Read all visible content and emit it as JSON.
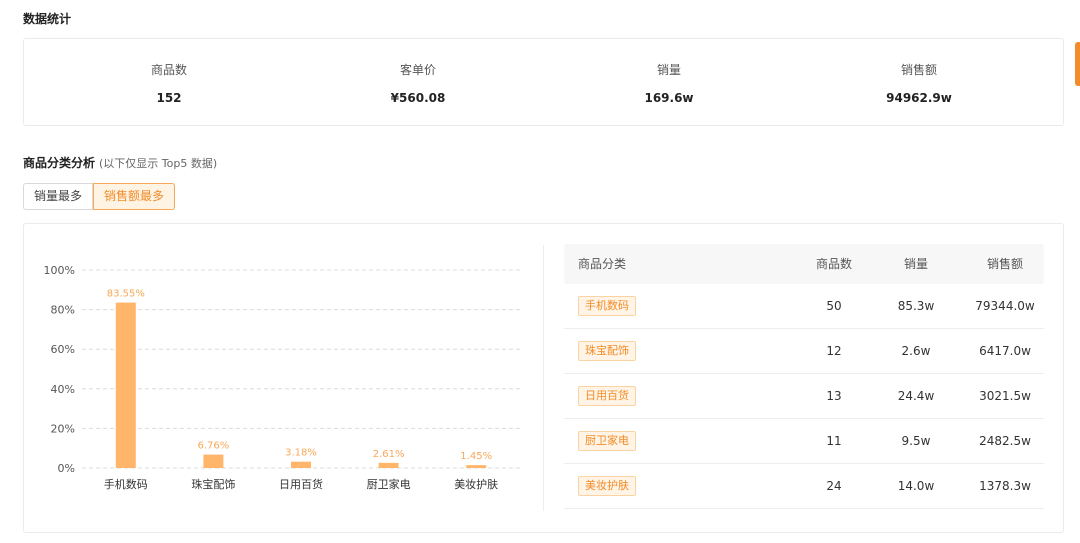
{
  "stats_section": {
    "title": "数据统计",
    "items": [
      {
        "label": "商品数",
        "value": "152"
      },
      {
        "label": "客单价",
        "value": "¥560.08"
      },
      {
        "label": "销量",
        "value": "169.6w"
      },
      {
        "label": "销售额",
        "value": "94962.9w"
      }
    ]
  },
  "category_section": {
    "title": "商品分类分析",
    "subtitle": "(以下仅显示 Top5 数据)",
    "tabs": [
      {
        "label": "销量最多",
        "active": false
      },
      {
        "label": "销售额最多",
        "active": true
      }
    ]
  },
  "chart_data": {
    "type": "bar",
    "categories": [
      "手机数码",
      "珠宝配饰",
      "日用百货",
      "厨卫家电",
      "美妆护肤"
    ],
    "values": [
      83.55,
      6.76,
      3.18,
      2.61,
      1.45
    ],
    "value_labels": [
      "83.55%",
      "6.76%",
      "3.18%",
      "2.61%",
      "1.45%"
    ],
    "y_ticks": [
      "0%",
      "20%",
      "40%",
      "60%",
      "80%",
      "100%"
    ],
    "ylim": [
      0,
      100
    ],
    "grid": true,
    "bar_color": "#ffb66b",
    "label_color": "#f7a858"
  },
  "table": {
    "headers": [
      "商品分类",
      "商品数",
      "销量",
      "销售额"
    ],
    "rows": [
      {
        "category": "手机数码",
        "count": "50",
        "sales": "85.3w",
        "revenue": "79344.0w"
      },
      {
        "category": "珠宝配饰",
        "count": "12",
        "sales": "2.6w",
        "revenue": "6417.0w"
      },
      {
        "category": "日用百货",
        "count": "13",
        "sales": "24.4w",
        "revenue": "3021.5w"
      },
      {
        "category": "厨卫家电",
        "count": "11",
        "sales": "9.5w",
        "revenue": "2482.5w"
      },
      {
        "category": "美妆护肤",
        "count": "24",
        "sales": "14.0w",
        "revenue": "1378.3w"
      }
    ]
  },
  "colors": {
    "accent": "#f28c28",
    "tag_bg": "#fff4e6",
    "border": "#ebebeb"
  }
}
